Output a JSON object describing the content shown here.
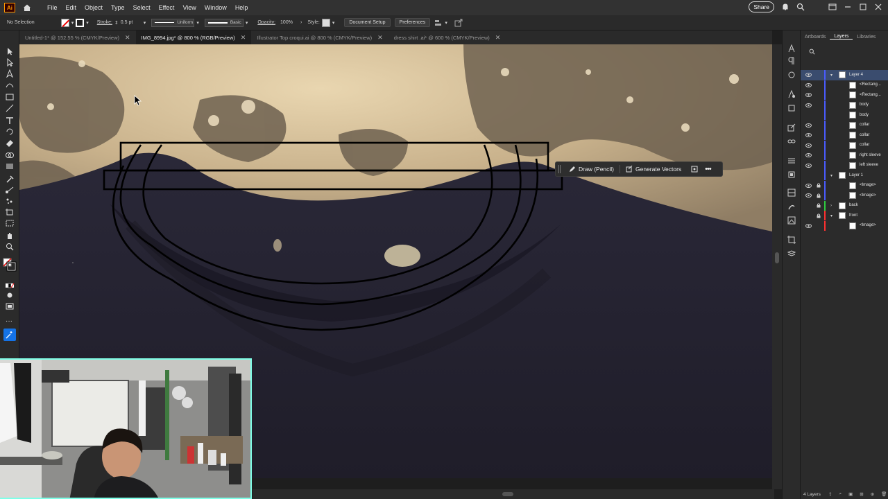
{
  "menubar": {
    "logo": "Ai",
    "items": [
      "File",
      "Edit",
      "Object",
      "Type",
      "Select",
      "Effect",
      "View",
      "Window",
      "Help"
    ],
    "share_label": "Share"
  },
  "control": {
    "selection": "No Selection",
    "stroke_label": "Stroke:",
    "stroke_value": "0.5 pt",
    "profile": "Uniform",
    "brush": "Basic",
    "opacity_label": "Opacity:",
    "opacity_value": "100%",
    "style_label": "Style:",
    "document_setup": "Document Setup",
    "preferences": "Preferences"
  },
  "tabs": [
    {
      "label": "Untitled-1* @ 152.55 % (CMYK/Preview)",
      "active": false
    },
    {
      "label": "IMG_8994.jpg* @ 800 % (RGB/Preview)",
      "active": true
    },
    {
      "label": "Illustrator Top croqui.ai @ 800 % (CMYK/Preview)",
      "active": false
    },
    {
      "label": "dress shirt .ai* @ 600 % (CMYK/Preview)",
      "active": false
    }
  ],
  "context_bar": {
    "draw_label": "Draw (Pencil)",
    "generate_label": "Generate Vectors"
  },
  "panel": {
    "tabs": [
      "Artboards",
      "Layers",
      "Libraries"
    ],
    "active_tab": "Layers",
    "footer": "4 Layers"
  },
  "layers": [
    {
      "name": "Layer 4",
      "level": 0,
      "twisty": "open",
      "selected": true,
      "color": "#4a5cff",
      "eye": true,
      "lock": false
    },
    {
      "name": "<Rectang...",
      "level": 1,
      "color": "#4a5cff",
      "eye": true,
      "lock": false
    },
    {
      "name": "<Rectang...",
      "level": 1,
      "color": "#4a5cff",
      "eye": true,
      "lock": false
    },
    {
      "name": "body",
      "level": 1,
      "color": "#4a5cff",
      "eye": true,
      "lock": false
    },
    {
      "name": "body",
      "level": 1,
      "color": "#4a5cff",
      "eye": false,
      "lock": false
    },
    {
      "name": "collar",
      "level": 1,
      "color": "#4a5cff",
      "eye": true,
      "lock": false
    },
    {
      "name": "collar",
      "level": 1,
      "color": "#4a5cff",
      "eye": true,
      "lock": false
    },
    {
      "name": "collar",
      "level": 1,
      "color": "#4a5cff",
      "eye": true,
      "lock": false
    },
    {
      "name": "right sleeve",
      "level": 1,
      "color": "#4a5cff",
      "eye": true,
      "lock": false
    },
    {
      "name": "left sleeve",
      "level": 1,
      "color": "#4a5cff",
      "eye": true,
      "lock": false
    },
    {
      "name": "Layer 1",
      "level": 0,
      "twisty": "open",
      "color": "#4a5cff",
      "eye": false,
      "lock": false
    },
    {
      "name": "<Image>",
      "level": 1,
      "color": "#4a5cff",
      "eye": true,
      "lock": true
    },
    {
      "name": "<Image>",
      "level": 1,
      "color": "#4a5cff",
      "eye": true,
      "lock": true
    },
    {
      "name": "back",
      "level": 0,
      "twisty": "closed",
      "color": "#2ecc40",
      "eye": false,
      "lock": true
    },
    {
      "name": "front",
      "level": 0,
      "twisty": "open",
      "color": "#ff3030",
      "eye": false,
      "lock": true
    },
    {
      "name": "<Image>",
      "level": 1,
      "color": "#ff3030",
      "eye": true,
      "lock": false
    }
  ]
}
